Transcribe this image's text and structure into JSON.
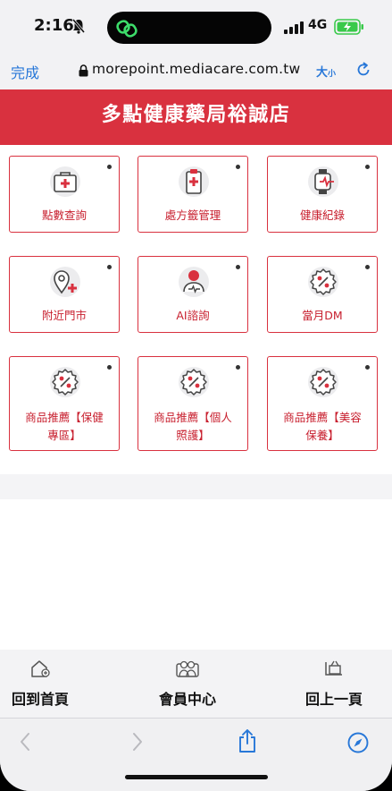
{
  "status_bar": {
    "time": "2:16",
    "network": "4G",
    "colors": {
      "island_icon": "#3ddc6a",
      "battery": "#39c94a"
    }
  },
  "browser": {
    "done_label": "完成",
    "url": "morepoint.mediacare.com.tw",
    "text_size_label": "大",
    "text_size_small": "小"
  },
  "page": {
    "title": "多點健康藥局裕誠店",
    "accent_color": "#d9313f",
    "tiles": [
      {
        "label": "點數查詢",
        "icon": "first-aid-kit-icon"
      },
      {
        "label": "處方籤管理",
        "icon": "prescription-clipboard-icon"
      },
      {
        "label": "健康紀錄",
        "icon": "health-watch-icon"
      },
      {
        "label": "附近門市",
        "icon": "location-pin-plus-icon"
      },
      {
        "label": "AI諮詢",
        "icon": "ai-consult-icon"
      },
      {
        "label": "當月DM",
        "icon": "promo-badge-icon"
      },
      {
        "label_line1": "商品推薦【保健",
        "label_line2": "專區】",
        "icon": "promo-badge-icon"
      },
      {
        "label_line1": "商品推薦【個人",
        "label_line2": "照護】",
        "icon": "promo-badge-icon"
      },
      {
        "label_line1": "商品推薦【美容",
        "label_line2": "保養】",
        "icon": "promo-badge-icon"
      }
    ]
  },
  "bottom_nav": {
    "items": [
      {
        "label": "回到首頁",
        "icon": "home-plus-icon"
      },
      {
        "label": "會員中心",
        "icon": "members-icon"
      },
      {
        "label": "回上一頁",
        "icon": "back-cart-icon"
      }
    ]
  },
  "safari_toolbar": {
    "icons": [
      "back-icon",
      "forward-icon",
      "share-icon",
      "compass-icon"
    ]
  }
}
